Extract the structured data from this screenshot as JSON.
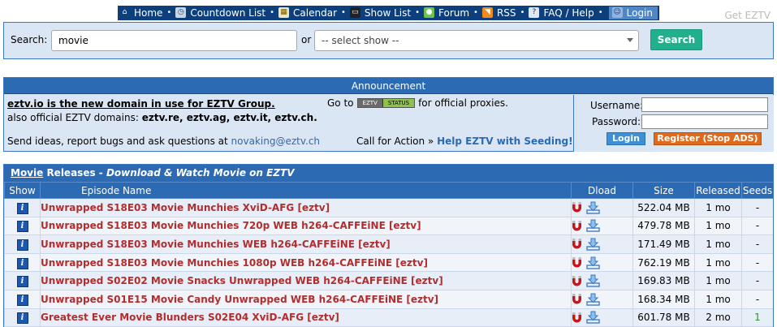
{
  "nav": {
    "items": [
      {
        "label": "Home",
        "icon": "home-icon"
      },
      {
        "label": "Countdown List",
        "icon": "clock-icon"
      },
      {
        "label": "Calendar",
        "icon": "calendar-icon"
      },
      {
        "label": "Show List",
        "icon": "tv-icon"
      },
      {
        "label": "Forum",
        "icon": "forum-icon"
      },
      {
        "label": "RSS",
        "icon": "rss-icon"
      },
      {
        "label": "FAQ / Help",
        "icon": "faq-icon"
      }
    ],
    "login_label": "Login",
    "get_eztv": "Get EZTV"
  },
  "search": {
    "label": "Search:",
    "value": "movie",
    "or_label": "or",
    "select_value": "-- select show --",
    "button_label": "Search"
  },
  "announcement": {
    "header": "Announcement",
    "domain_line": "eztv.io is the new domain in use for EZTV Group.",
    "also_prefix": "also official EZTV domains:",
    "also_domains": "eztv.re, eztv.ag, eztv.it, eztv.ch.",
    "send_text": "Send ideas, report bugs and ask questions at",
    "email": "novaking@eztv.ch",
    "goto_prefix": "Go to",
    "badge_a": "EZTV",
    "badge_b": "STATUS",
    "goto_suffix": "for official proxies.",
    "cfa_prefix": "Call for Action »",
    "cfa_link": "Help EZTV with Seeding!"
  },
  "login": {
    "username_label": "Username:",
    "password_label": "Password:",
    "login_button": "Login",
    "register_button": "Register (Stop ADS)"
  },
  "releases": {
    "title_link": "Movie",
    "title_rest": " Releases - ",
    "subtitle": "Download & Watch Movie on EZTV",
    "columns": [
      "Show",
      "Episode Name",
      "Dload",
      "Size",
      "Released",
      "Seeds"
    ],
    "rows": [
      {
        "name": "Unwrapped S18E03 Movie Munchies XviD-AFG [eztv]",
        "size": "522.04 MB",
        "released": "1 mo",
        "seeds": "-"
      },
      {
        "name": "Unwrapped S18E03 Movie Munchies 720p WEB h264-CAFFEiNE [eztv]",
        "size": "479.78 MB",
        "released": "1 mo",
        "seeds": "-"
      },
      {
        "name": "Unwrapped S18E03 Movie Munchies WEB h264-CAFFEiNE [eztv]",
        "size": "171.49 MB",
        "released": "1 mo",
        "seeds": "-"
      },
      {
        "name": "Unwrapped S18E03 Movie Munchies 1080p WEB h264-CAFFEiNE [eztv]",
        "size": "762.19 MB",
        "released": "1 mo",
        "seeds": "-"
      },
      {
        "name": "Unwrapped S02E02 Movie Snacks Unwrapped WEB h264-CAFFEiNE [eztv]",
        "size": "169.83 MB",
        "released": "1 mo",
        "seeds": "-"
      },
      {
        "name": "Unwrapped S01E15 Movie Candy Unwrapped WEB h264-CAFFEiNE [eztv]",
        "size": "168.34 MB",
        "released": "1 mo",
        "seeds": "-"
      },
      {
        "name": "Greatest Ever Movie Blunders S02E04 XviD-AFG [eztv]",
        "size": "601.78 MB",
        "released": "2 mo",
        "seeds": "1"
      }
    ]
  },
  "colors": {
    "nav_bg": "#0d3f7d",
    "header_blue": "#2d6ab4",
    "panel_bg": "#dbe6f4",
    "episode_link": "#b22e2e",
    "search_button": "#20b08e",
    "register_button": "#e06a1b"
  }
}
